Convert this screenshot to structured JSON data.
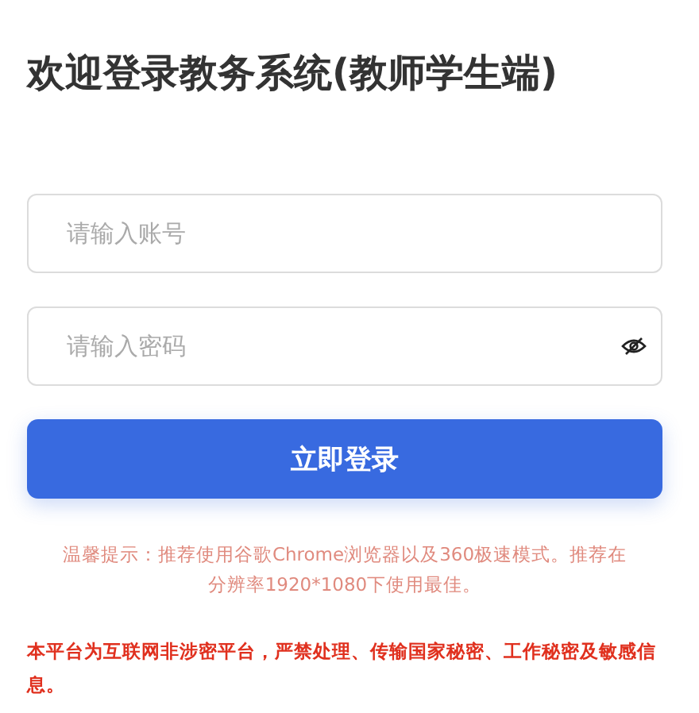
{
  "title": "欢迎登录教务系统(教师学生端)",
  "fields": [
    {
      "kind": "text",
      "placeholder": "请输入账号"
    },
    {
      "kind": "password",
      "placeholder": "请输入密码"
    }
  ],
  "login_button": "立即登录",
  "tip": "温馨提示：推荐使用谷歌Chrome浏览器以及360极速模式。推荐在分辨率1920*1080下使用最佳。",
  "warning": "本平台为互联网非涉密平台，严禁处理、传输国家秘密、工作秘密及敏感信息。"
}
